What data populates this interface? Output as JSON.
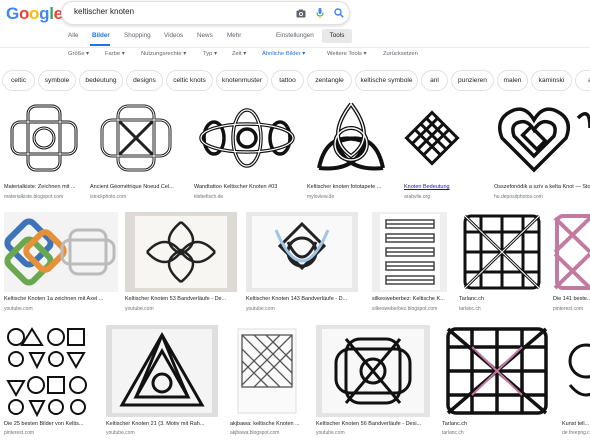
{
  "logo": {
    "letters": [
      "G",
      "o",
      "o",
      "g",
      "l",
      "e"
    ],
    "colors": [
      "#4285f4",
      "#ea4335",
      "#fbbc05",
      "#4285f4",
      "#34a853",
      "#ea4335"
    ]
  },
  "search": {
    "query": "keltischer knoten"
  },
  "tabs": [
    {
      "label": "Alle",
      "active": false
    },
    {
      "label": "Bilder",
      "active": true
    },
    {
      "label": "Shopping",
      "active": false
    },
    {
      "label": "Videos",
      "active": false
    },
    {
      "label": "News",
      "active": false
    },
    {
      "label": "Mehr",
      "active": false
    }
  ],
  "settings_label": "Einstellungen",
  "tools_label": "Tools",
  "filters": [
    {
      "label": "Größe ▾",
      "active": false
    },
    {
      "label": "Farbe ▾",
      "active": false
    },
    {
      "label": "Nutzungsrechte ▾",
      "active": false
    },
    {
      "label": "Typ ▾",
      "active": false
    },
    {
      "label": "Zeit ▾",
      "active": false
    },
    {
      "label": "Ähnliche Bilder ▾",
      "active": true
    },
    {
      "label": "Weitere Tools ▾",
      "active": false
    },
    {
      "label": "Zurücksetzen",
      "active": false
    }
  ],
  "chips": [
    "celtic",
    "symbole",
    "bedeutung",
    "designs",
    "celtic knots",
    "knotenmuster",
    "tattoo",
    "zentangle",
    "keltische symbole",
    "anl",
    "punzieren",
    "malen",
    "kaminski",
    "a"
  ],
  "rows": [
    [
      {
        "caption": "Materialkiste: Zeichnen mit ...",
        "source": "materialkiste.blogspot.com",
        "link": false
      },
      {
        "caption": "Ancient Géométrique Noeud Cel...",
        "source": "istockphoto.com",
        "link": false
      },
      {
        "caption": "Wandtattoo Keltischer Knoten #03",
        "source": "klebefisch.de",
        "link": false
      },
      {
        "caption": "Keltischer knoten fototapete ...",
        "source": "myloview.de",
        "link": false
      },
      {
        "caption": "Knoten Bedeutung",
        "source": "arabvile.org",
        "link": true
      },
      {
        "caption": "Összefonódik a szív a kelta Knot — Stock ...",
        "source": "hu.depositphotos.com",
        "link": false
      }
    ],
    [
      {
        "caption": "Keltische Knoten 1a zeichnen mit Axel ...",
        "source": "youtube.com",
        "link": false
      },
      {
        "caption": "Keltischer Knoten 53 Bandverläufe - De...",
        "source": "youtube.com",
        "link": false
      },
      {
        "caption": "Keltischer Knoten 143 Bandverläufe - D...",
        "source": "youtube.com",
        "link": false
      },
      {
        "caption": "silkesweberbez: Keltische K...",
        "source": "silkesweberbez.blogspot.com",
        "link": false
      },
      {
        "caption": "Tarlanc.ch",
        "source": "tarlanc.ch",
        "link": false
      },
      {
        "caption": "Die 141 beste...",
        "source": "pinterest.com",
        "link": false
      }
    ],
    [
      {
        "caption": "Die 25 besten Bilder von Keltis...",
        "source": "pinterest.com",
        "link": false
      },
      {
        "caption": "Keltischer Knoten 21 (3. Motiv mit Rah...",
        "source": "youtube.com",
        "link": false
      },
      {
        "caption": "akjbawa: keltische Knoten ...",
        "source": "akjbawa.blogspot.com",
        "link": false
      },
      {
        "caption": "Keltischer Knoten 56 Bandverläufe - Desi...",
        "source": "youtube.com",
        "link": false
      },
      {
        "caption": "Tarlanc.ch",
        "source": "tarlanc.ch",
        "link": false
      },
      {
        "caption": "Kunst tell...",
        "source": "de.freepng.com",
        "link": false
      }
    ]
  ]
}
